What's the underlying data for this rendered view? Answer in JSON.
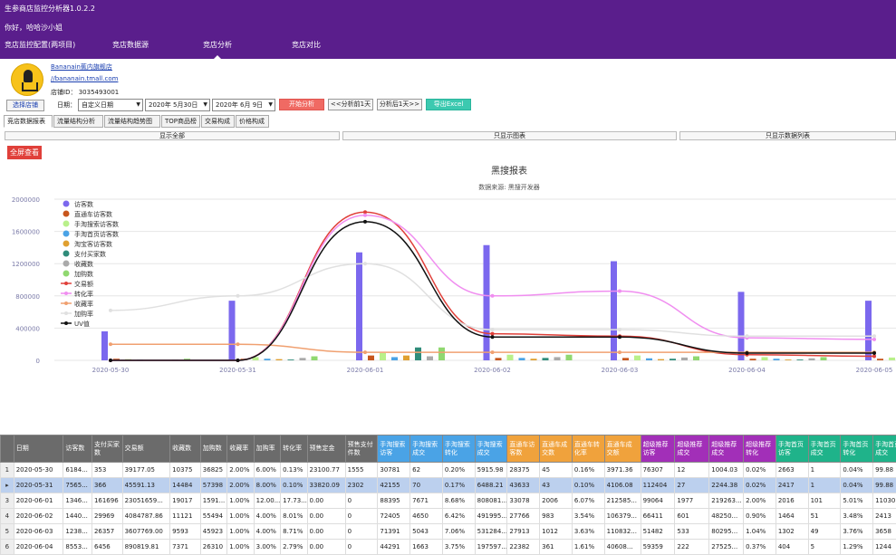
{
  "app": {
    "title": "生参商店监控分析器1.0.2.2",
    "greeting": "你好，哈哈沙小姐",
    "menu": [
      "竞店监控配置(两项目)",
      "竞店数据源",
      "竞店分析",
      "竞店对比"
    ],
    "active_menu": 2
  },
  "shop": {
    "name": "Bananain蕉内旗舰店",
    "url": "//bananain.tmall.com",
    "id_label": "店铺ID：",
    "id_value": "3035493001",
    "select_button": "选择店铺"
  },
  "filters": {
    "date_label": "日期：",
    "range_type": "自定义日期",
    "start_date": "2020年 5月30日",
    "end_date": "2020年 6月 9日",
    "start_button": "开始分析",
    "prev_day_button": "<<分析前1天",
    "next_day_button": "分析后1天>>",
    "export_button": "导出Excel"
  },
  "tabs": [
    "竞店数据报表",
    "流量结构分析",
    "流量结构趋势图",
    "TOP商品榜",
    "交易构成",
    "价格构成"
  ],
  "view_buttons": [
    "显示全部",
    "只显示图表",
    "只显示数据列表"
  ],
  "fullscreen_button": "全屏查看",
  "colors": {
    "topbar": "#5a1e8c",
    "visitors": "#7b68ee",
    "direct": "#c8561d",
    "search": "#b9f08a",
    "home": "#4aa3e6",
    "taoke": "#e0a030",
    "buyers": "#2f8c7a",
    "trade": "#e0403a",
    "favorites": "#aaaaaa",
    "cart": "#90d870",
    "conversion": "#f08ef0",
    "fav_rate": "#f0a070",
    "cart_rate": "#e0e0e0",
    "uv": "#111111"
  },
  "chart_data": {
    "type": "bar",
    "title": "黑搜报表",
    "subtitle": "数据来源: 黑搜开发器",
    "categories": [
      "2020-05-30",
      "2020-05-31",
      "2020-06-01",
      "2020-06-02",
      "2020-06-03",
      "2020-06-04",
      "2020-06-05"
    ],
    "ylim": [
      0,
      2000000
    ],
    "y_ticks": [
      "2000000",
      "1600000",
      "1200000",
      "800000",
      "400000",
      "0"
    ],
    "legend_position": "top-left",
    "series": [
      {
        "name": "访客数",
        "kind": "bar",
        "color": "#7b68ee",
        "values": [
          360000,
          740000,
          1340000,
          1430000,
          1230000,
          850000,
          740000
        ]
      },
      {
        "name": "直通车访客数",
        "kind": "bar",
        "color": "#c8561d",
        "values": [
          20000,
          20000,
          60000,
          30000,
          30000,
          20000,
          20000
        ]
      },
      {
        "name": "手淘搜索访客数",
        "kind": "bar",
        "color": "#b9f08a",
        "values": [
          15000,
          40000,
          90000,
          70000,
          60000,
          40000,
          35000
        ]
      },
      {
        "name": "手淘首页访客数",
        "kind": "bar",
        "color": "#4aa3e6",
        "values": [
          10000,
          20000,
          40000,
          30000,
          25000,
          20000,
          15000
        ]
      },
      {
        "name": "淘宝客访客数",
        "kind": "bar",
        "color": "#e0a030",
        "values": [
          5000,
          15000,
          60000,
          20000,
          15000,
          10000,
          10000
        ]
      },
      {
        "name": "支付买家数",
        "kind": "bar",
        "color": "#2f8c7a",
        "values": [
          5000,
          10000,
          160000,
          30000,
          20000,
          10000,
          10000
        ]
      },
      {
        "name": "收藏数",
        "kind": "bar",
        "color": "#aaaaaa",
        "values": [
          10000,
          30000,
          50000,
          40000,
          35000,
          25000,
          20000
        ]
      },
      {
        "name": "加购数",
        "kind": "bar",
        "color": "#90d870",
        "values": [
          20000,
          50000,
          160000,
          70000,
          50000,
          40000,
          35000
        ]
      },
      {
        "name": "交易额",
        "kind": "line",
        "color": "#e0403a",
        "values": [
          0,
          0,
          1840000,
          330000,
          300000,
          70000,
          50000
        ]
      },
      {
        "name": "转化率",
        "kind": "line",
        "color": "#f08ef0",
        "values": [
          0,
          0,
          1800000,
          800000,
          860000,
          280000,
          260000
        ]
      },
      {
        "name": "收藏率",
        "kind": "line",
        "color": "#f0a070",
        "values": [
          200000,
          200000,
          100000,
          100000,
          100000,
          100000,
          100000
        ]
      },
      {
        "name": "加购率",
        "kind": "line",
        "color": "#e0e0e0",
        "values": [
          620000,
          800000,
          1200000,
          380000,
          380000,
          300000,
          300000
        ]
      },
      {
        "name": "UV值",
        "kind": "line",
        "color": "#111111",
        "values": [
          0,
          0,
          1720000,
          290000,
          290000,
          90000,
          90000
        ]
      }
    ]
  },
  "table": {
    "columns": [
      {
        "label": "日期",
        "group": "base"
      },
      {
        "label": "访客数",
        "group": "base"
      },
      {
        "label": "支付买家数",
        "group": "base"
      },
      {
        "label": "交易额",
        "group": "base"
      },
      {
        "label": "收藏数",
        "group": "base"
      },
      {
        "label": "加购数",
        "group": "base"
      },
      {
        "label": "收藏率",
        "group": "base"
      },
      {
        "label": "加购率",
        "group": "base"
      },
      {
        "label": "转化率",
        "group": "base"
      },
      {
        "label": "预售定金",
        "group": "base"
      },
      {
        "label": "预售支付件数",
        "group": "base"
      },
      {
        "label": "手淘搜索访客",
        "group": "taobao"
      },
      {
        "label": "手淘搜索成交",
        "group": "taobao"
      },
      {
        "label": "手淘搜索转化",
        "group": "taobao"
      },
      {
        "label": "手淘搜索成交",
        "group": "taobao"
      },
      {
        "label": "直通车访客数",
        "group": "direct"
      },
      {
        "label": "直通车成交数",
        "group": "direct"
      },
      {
        "label": "直通车转化率",
        "group": "direct"
      },
      {
        "label": "直通车成交额",
        "group": "direct"
      },
      {
        "label": "超级推荐访客",
        "group": "super"
      },
      {
        "label": "超级推荐成交",
        "group": "super"
      },
      {
        "label": "超级推荐成交",
        "group": "super"
      },
      {
        "label": "超级推荐转化",
        "group": "super"
      },
      {
        "label": "手淘首页访客",
        "group": "home"
      },
      {
        "label": "手淘首页成交",
        "group": "home"
      },
      {
        "label": "手淘首页转化",
        "group": "home"
      },
      {
        "label": "手淘首页成交",
        "group": "home"
      }
    ],
    "rows": [
      [
        "2020-05-30",
        "6184...",
        "353",
        "39177.05",
        "10375",
        "36825",
        "2.00%",
        "6.00%",
        "0.13%",
        "23100.77",
        "1555",
        "30781",
        "62",
        "0.20%",
        "5915.98",
        "28375",
        "45",
        "0.16%",
        "3971.36",
        "76307",
        "12",
        "1004.03",
        "0.02%",
        "2663",
        "1",
        "0.04%",
        "99.88"
      ],
      [
        "2020-05-31",
        "7565...",
        "366",
        "45591.13",
        "14484",
        "57398",
        "2.00%",
        "8.00%",
        "0.10%",
        "33820.09",
        "2302",
        "42155",
        "70",
        "0.17%",
        "6488.21",
        "43633",
        "43",
        "0.10%",
        "4106.08",
        "112404",
        "27",
        "2244.38",
        "0.02%",
        "2417",
        "1",
        "0.04%",
        "99.88"
      ],
      [
        "2020-06-01",
        "1346...",
        "161696",
        "23051659...",
        "19017",
        "1591...",
        "1.00%",
        "12.00...",
        "17.73...",
        "0.00",
        "0",
        "88395",
        "7671",
        "8.68%",
        "808081...",
        "33078",
        "2006",
        "6.07%",
        "212585...",
        "99064",
        "1977",
        "219263...",
        "2.00%",
        "2016",
        "101",
        "5.01%",
        "11030"
      ],
      [
        "2020-06-02",
        "1440...",
        "29969",
        "4084787.86",
        "11121",
        "55494",
        "1.00%",
        "4.00%",
        "8.01%",
        "0.00",
        "0",
        "72405",
        "4650",
        "6.42%",
        "491995...",
        "27766",
        "983",
        "3.54%",
        "106379...",
        "66411",
        "601",
        "48250...",
        "0.90%",
        "1464",
        "51",
        "3.48%",
        "2413"
      ],
      [
        "2020-06-03",
        "1238...",
        "26357",
        "3607769.00",
        "9593",
        "45923",
        "1.00%",
        "4.00%",
        "8.71%",
        "0.00",
        "0",
        "71391",
        "5043",
        "7.06%",
        "531284...",
        "27913",
        "1012",
        "3.63%",
        "110832...",
        "51482",
        "533",
        "80295...",
        "1.04%",
        "1302",
        "49",
        "3.76%",
        "3658"
      ],
      [
        "2020-06-04",
        "8553...",
        "6456",
        "890819.81",
        "7371",
        "26310",
        "1.00%",
        "3.00%",
        "2.79%",
        "0.00",
        "0",
        "44291",
        "1663",
        "3.75%",
        "197597...",
        "22382",
        "361",
        "1.61%",
        "40608...",
        "59359",
        "222",
        "27525...",
        "0.37%",
        "404",
        "5",
        "1.29%",
        "1244"
      ]
    ],
    "selected_row": 1
  }
}
